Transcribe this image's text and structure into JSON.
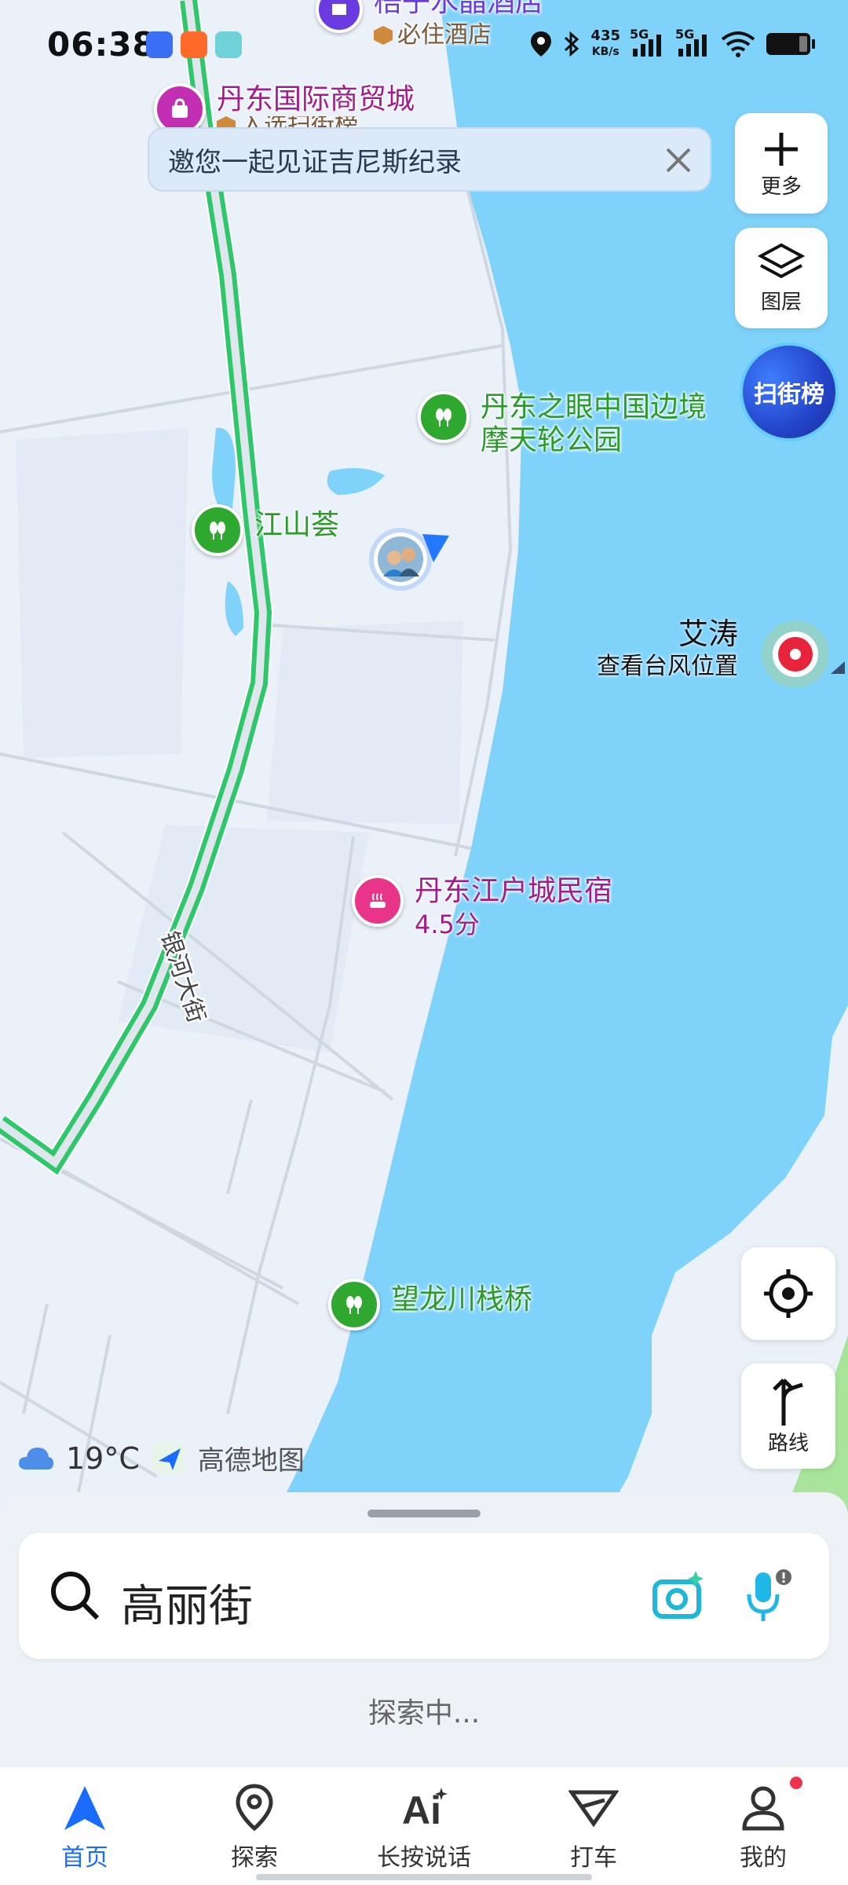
{
  "status_bar": {
    "time": "06:38",
    "net_speed_value": "435",
    "net_speed_unit": "KB/s",
    "signal1_label": "5G",
    "signal2_label": "5G"
  },
  "banner": {
    "text": "邀您一起见证吉尼斯纪录"
  },
  "map": {
    "poi_top_hotel": "梧子水晶酒店",
    "poi_top_hotel_sub": "必住酒店",
    "poi_mall": "丹东国际商贸城",
    "poi_mall_sub": "入选扫街榜",
    "poi_ferris_line1": "丹东之眼中国边境",
    "poi_ferris_line2": "摩天轮公园",
    "poi_jiangshan": "江山荟",
    "poi_minsu": "丹东江户城民宿",
    "poi_minsu_rating": "4.5分",
    "poi_wanglong": "望龙川栈桥",
    "road_label": "银河大街"
  },
  "side_buttons": {
    "more_label": "更多",
    "layers_label": "图层",
    "scan_label": "扫街榜",
    "route_label": "路线"
  },
  "typhoon": {
    "name": "艾涛",
    "sub": "查看台风位置"
  },
  "weather": {
    "temp": "19°C",
    "brand": "高德地图"
  },
  "search": {
    "query": "高丽街",
    "status": "探索中..."
  },
  "nav": {
    "items": [
      {
        "label": "首页"
      },
      {
        "label": "探索"
      },
      {
        "label": "长按说话"
      },
      {
        "label": "打车"
      },
      {
        "label": "我的"
      }
    ]
  },
  "colors": {
    "water": "#7fd3fb",
    "land": "#eaf1f8",
    "road_green": "#2ec76a",
    "accent_blue": "#1a6cff",
    "poi_green": "#2fa82f",
    "poi_purple": "#a11c8d",
    "poi_pink": "#e8358a"
  }
}
